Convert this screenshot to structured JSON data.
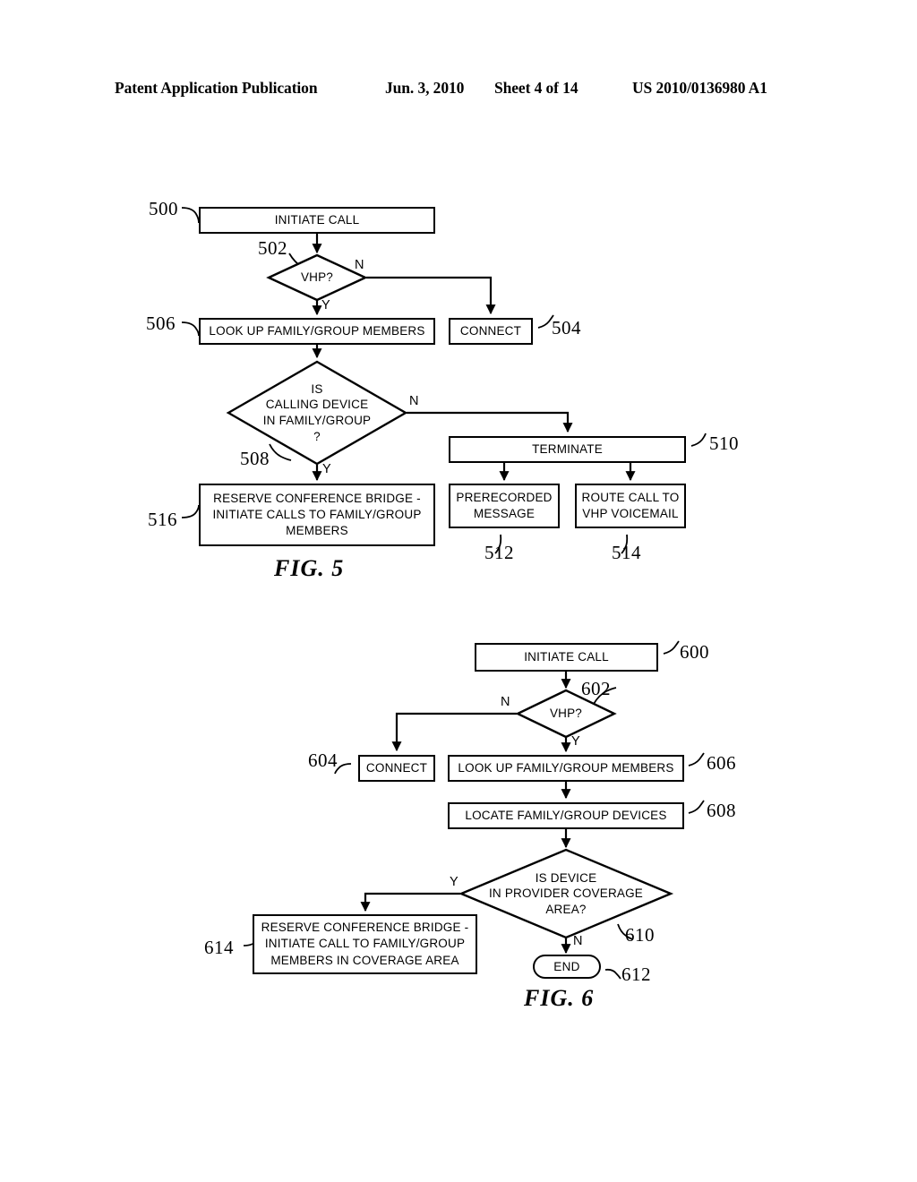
{
  "header": {
    "publication": "Patent Application Publication",
    "date": "Jun. 3, 2010",
    "sheet": "Sheet 4 of 14",
    "docnum": "US 2010/0136980 A1"
  },
  "figures": [
    {
      "caption": "FIG. 5",
      "nodes": {
        "n500": {
          "label": "INITIATE CALL",
          "ref": "500"
        },
        "n502": {
          "label": "VHP?",
          "ref": "502"
        },
        "n504": {
          "label": "CONNECT",
          "ref": "504"
        },
        "n506": {
          "label": "LOOK UP FAMILY/GROUP MEMBERS",
          "ref": "506"
        },
        "n508": {
          "label": "IS\nCALLING DEVICE\nIN FAMILY/GROUP\n?",
          "ref": "508"
        },
        "n510": {
          "label": "TERMINATE",
          "ref": "510"
        },
        "n512": {
          "label": "PRERECORDED MESSAGE",
          "ref": "512"
        },
        "n514": {
          "label": "ROUTE CALL TO VHP VOICEMAIL",
          "ref": "514"
        },
        "n516": {
          "label": "RESERVE CONFERENCE BRIDGE - INITIATE CALLS TO FAMILY/GROUP MEMBERS",
          "ref": "516"
        }
      },
      "branches": {
        "b502n": "N",
        "b502y": "Y",
        "b508n": "N",
        "b508y": "Y"
      }
    },
    {
      "caption": "FIG. 6",
      "nodes": {
        "n600": {
          "label": "INITIATE CALL",
          "ref": "600"
        },
        "n602": {
          "label": "VHP?",
          "ref": "602"
        },
        "n604": {
          "label": "CONNECT",
          "ref": "604"
        },
        "n606": {
          "label": "LOOK UP FAMILY/GROUP MEMBERS",
          "ref": "606"
        },
        "n608": {
          "label": "LOCATE FAMILY/GROUP DEVICES",
          "ref": "608"
        },
        "n610": {
          "label": "IS DEVICE\nIN PROVIDER COVERAGE\nAREA?",
          "ref": "610"
        },
        "n612": {
          "label": "END",
          "ref": "612"
        },
        "n614": {
          "label": "RESERVE CONFERENCE BRIDGE - INITIATE CALL TO FAMILY/GROUP MEMBERS IN COVERAGE AREA",
          "ref": "614"
        }
      },
      "branches": {
        "b602n": "N",
        "b602y": "Y",
        "b610y": "Y",
        "b610n": "N"
      }
    }
  ]
}
